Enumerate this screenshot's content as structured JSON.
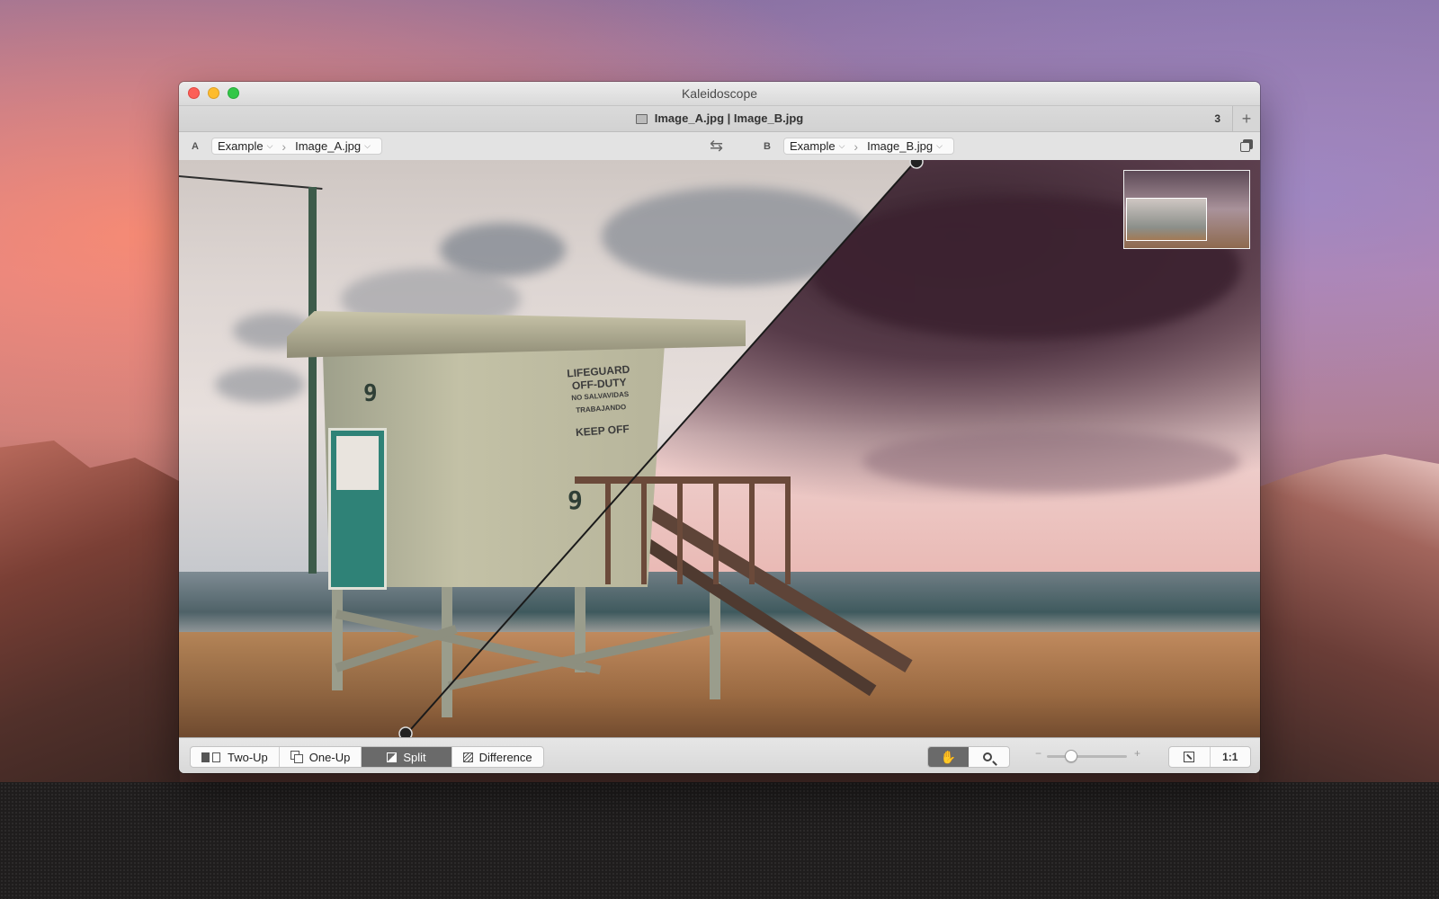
{
  "window": {
    "title": "Kaleidoscope"
  },
  "tab": {
    "title": "Image_A.jpg | Image_B.jpg",
    "count": "3",
    "add_label": "+"
  },
  "pathbar": {
    "side_a": {
      "label": "A",
      "folder": "Example",
      "file": "Image_A.jpg"
    },
    "side_b": {
      "label": "B",
      "folder": "Example",
      "file": "Image_B.jpg"
    },
    "swap_glyph": "⇆"
  },
  "image": {
    "sign_lines": [
      "LIFEGUARD",
      "OFF-DUTY",
      "NO SALVAVIDAS",
      "TRABAJANDO",
      "KEEP OFF"
    ],
    "tower_number": "9"
  },
  "toolbar": {
    "modes": [
      {
        "label": "Two-Up",
        "icon": "two-up-icon",
        "active": false
      },
      {
        "label": "One-Up",
        "icon": "one-up-icon",
        "active": false
      },
      {
        "label": "Split",
        "icon": "split-icon",
        "active": true
      },
      {
        "label": "Difference",
        "icon": "difference-icon",
        "active": false
      }
    ],
    "tools": [
      {
        "icon": "hand-icon",
        "glyph": "✋",
        "active": true
      },
      {
        "icon": "magnifier-icon",
        "active": false
      }
    ],
    "zoom": {
      "minus": "−",
      "plus": "+",
      "level": 0.3
    },
    "actual_size_label": "1:1"
  },
  "colors": {
    "active_segment": "#6a6a6a",
    "close": "#fc5f57",
    "minimize": "#fdbc2e",
    "maximize": "#33c748"
  }
}
